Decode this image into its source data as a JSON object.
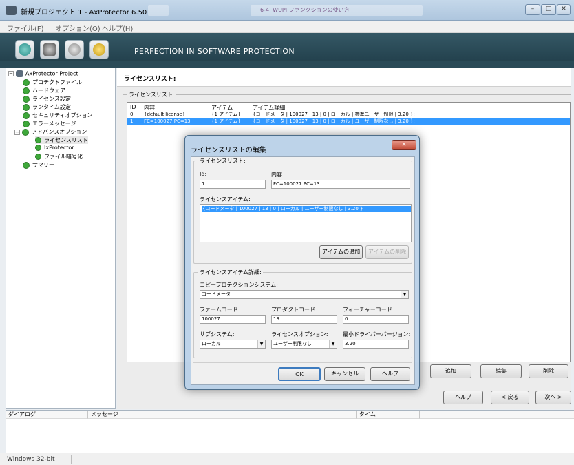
{
  "window": {
    "title": "新規プロジェクト 1 - AxProtector 6.50",
    "background_window_title": "6-4. WUPI ファンクションの使い方"
  },
  "menu": [
    "ファイル(F)",
    "オプション(O)",
    "ヘルプ(H)"
  ],
  "banner": {
    "text": "PERFECTION IN SOFTWARE PROTECTION"
  },
  "tree": {
    "root": "AxProtector Project",
    "items": [
      "プロテクトファイル",
      "ハードウェア",
      "ライセンス設定",
      "ランタイム設定",
      "セキュリティオプション",
      "エラーメッセージ",
      "アドバンスオプション"
    ],
    "advanced_children": [
      "ライセンスリスト",
      "IxProtector",
      "ファイル暗号化"
    ],
    "last": "サマリー"
  },
  "panel": {
    "header": "ライセンスリスト:",
    "group_title": "ライセンスリスト:",
    "columns": [
      "ID",
      "内容",
      "アイテム",
      "アイテム詳細"
    ],
    "rows": [
      [
        "0",
        "{default license}",
        "{1 アイテム}",
        "{コードメータ | 100027 | 13 | 0 | ローカル | 標準ユーザー制限 | 3.20 };"
      ],
      [
        "1",
        "FC=100027 PC=13",
        "{1 アイテム}",
        "{コードメータ | 100027 | 13 | 0 | ローカル | ユーザー制限なし | 3.20 };"
      ]
    ],
    "buttons": {
      "add": "追加",
      "edit": "編集",
      "delete": "削除"
    }
  },
  "nav": {
    "help": "ヘルプ",
    "back": "< 戻る",
    "next": "次へ >"
  },
  "log": {
    "columns": [
      "ダイアログ",
      "メッセージ",
      "タイム"
    ]
  },
  "status": {
    "platform": "Windows 32-bit"
  },
  "dialog": {
    "title": "ライセンスリストの編集",
    "close": "x",
    "license_group": "ライセンスリスト:",
    "id_label": "Id:",
    "id_value": "1",
    "content_label": "内容:",
    "content_value": "FC=100027 PC=13",
    "items_label": "ライセンスアイテム:",
    "item_value": "{コードメータ | 100027 | 13 | 0 | ローカル | ユーザー制限なし | 3.20 }",
    "add_item": "アイテムの追加",
    "remove_item": "アイテムの削除",
    "detail_group": "ライセンスアイテム詳細:",
    "copy_label": "コピープロテクションシステム:",
    "copy_value": "コードメータ",
    "firm_label": "ファームコード:",
    "firm_value": "100027",
    "product_label": "プロダクトコード:",
    "product_value": "13",
    "feature_label": "フィーチャーコード:",
    "feature_value": "0",
    "feature_btn": "...",
    "subsystem_label": "サブシステム:",
    "subsystem_value": "ローカル",
    "licopt_label": "ライセンスオプション:",
    "licopt_value": "ユーザー制限なし",
    "driver_label": "最小ドライバーバージョン:",
    "driver_value": "3.20",
    "ok": "OK",
    "cancel": "キャンセル",
    "help": "ヘルプ"
  },
  "colors": {
    "selection": "#3399ff",
    "banner": "#2a4a57",
    "check": "#3ea83a"
  }
}
